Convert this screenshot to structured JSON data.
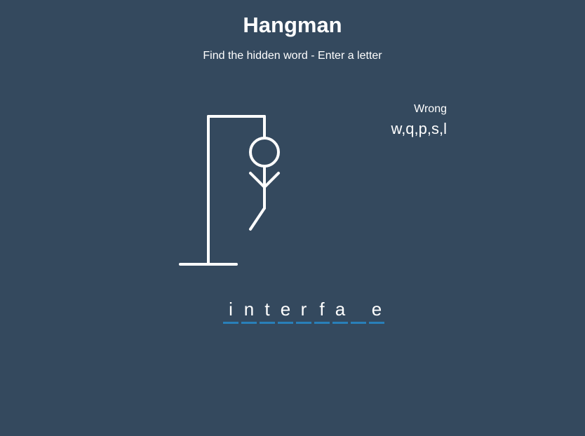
{
  "header": {
    "title": "Hangman",
    "subtitle": "Find the hidden word - Enter a letter"
  },
  "wrong": {
    "label": "Wrong",
    "letters": "w,q,p,s,l"
  },
  "word": {
    "slots": [
      "i",
      "n",
      "t",
      "e",
      "r",
      "f",
      "a",
      "",
      "e"
    ]
  },
  "colors": {
    "background": "#34495e",
    "foreground": "#ffffff",
    "underline": "#2980b9"
  },
  "figure": {
    "parts_shown": [
      "gallows",
      "head",
      "body",
      "left-arm",
      "right-arm",
      "left-leg"
    ]
  }
}
